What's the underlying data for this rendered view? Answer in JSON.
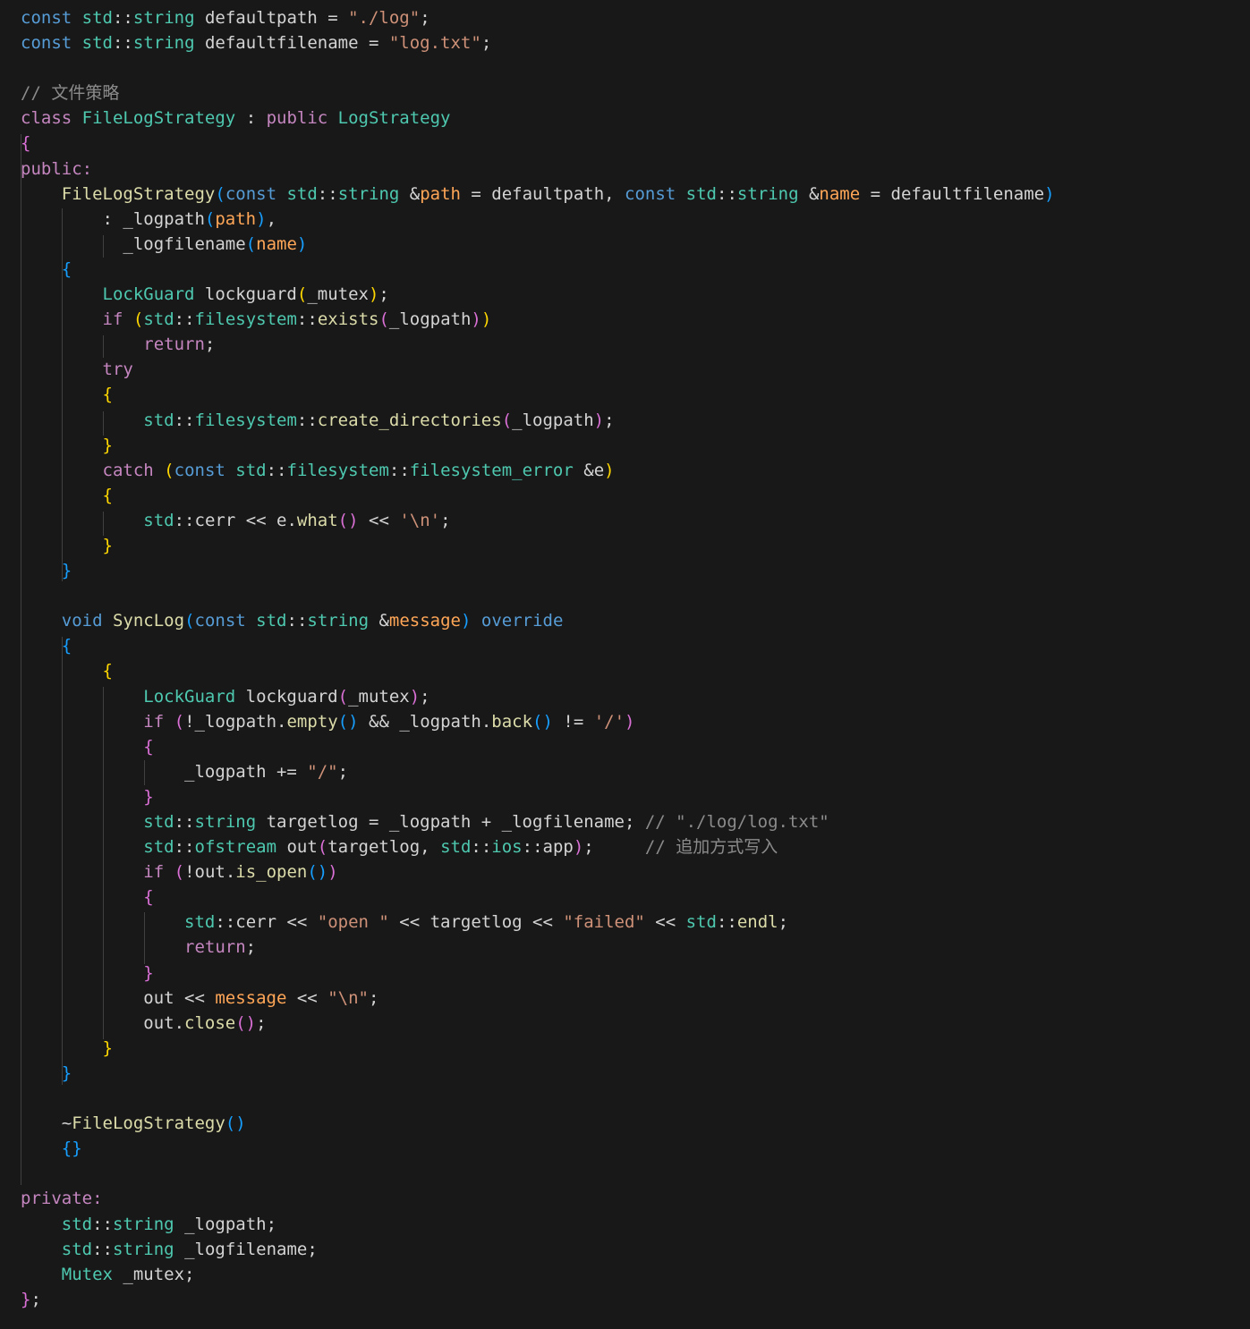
{
  "colors": {
    "background": "#181818",
    "guide": "#404040",
    "default": "#d4d4d4",
    "keyword": "#569cd6",
    "type": "#4ec9b0",
    "control": "#c586c0",
    "function": "#dcdcaa",
    "string": "#ce9178",
    "comment": "#8b8b8b",
    "param": "#ffa657",
    "bracket1": "#ffd700",
    "bracket2": "#da70d6",
    "bracket3": "#179fff",
    "name": "#ffffff"
  },
  "lines": [
    [
      [
        "const",
        "keyword"
      ],
      [
        " ",
        "plain"
      ],
      [
        "std",
        "type"
      ],
      [
        "::",
        "plain"
      ],
      [
        "string",
        "type"
      ],
      [
        " defaultpath = ",
        "plain"
      ],
      [
        "\"./log\"",
        "string"
      ],
      [
        ";",
        "plain"
      ]
    ],
    [
      [
        "const",
        "keyword"
      ],
      [
        " ",
        "plain"
      ],
      [
        "std",
        "type"
      ],
      [
        "::",
        "plain"
      ],
      [
        "string",
        "type"
      ],
      [
        " defaultfilename = ",
        "plain"
      ],
      [
        "\"log.txt\"",
        "string"
      ],
      [
        ";",
        "plain"
      ]
    ],
    [],
    [
      [
        "// 文件策略",
        "comment"
      ]
    ],
    [
      [
        "class",
        "control"
      ],
      [
        " ",
        "plain"
      ],
      [
        "FileLogStrategy",
        "type"
      ],
      [
        " : ",
        "plain"
      ],
      [
        "public",
        "control"
      ],
      [
        " ",
        "plain"
      ],
      [
        "LogStrategy",
        "type"
      ]
    ],
    [
      [
        "{",
        "bracket2"
      ]
    ],
    [
      [
        "public:",
        "control"
      ]
    ],
    [
      [
        "    ",
        "plain"
      ],
      [
        "FileLogStrategy",
        "function"
      ],
      [
        "(",
        "bracket3"
      ],
      [
        "const",
        "keyword"
      ],
      [
        " ",
        "plain"
      ],
      [
        "std",
        "type"
      ],
      [
        "::",
        "plain"
      ],
      [
        "string",
        "type"
      ],
      [
        " &",
        "plain"
      ],
      [
        "path",
        "param"
      ],
      [
        " = defaultpath, ",
        "plain"
      ],
      [
        "const",
        "keyword"
      ],
      [
        " ",
        "plain"
      ],
      [
        "std",
        "type"
      ],
      [
        "::",
        "plain"
      ],
      [
        "string",
        "type"
      ],
      [
        " &",
        "plain"
      ],
      [
        "name",
        "param"
      ],
      [
        " = defaultfilename",
        "plain"
      ],
      [
        ")",
        "bracket3"
      ]
    ],
    [
      [
        "        : _logpath",
        "plain"
      ],
      [
        "(",
        "bracket3"
      ],
      [
        "path",
        "param"
      ],
      [
        ")",
        "bracket3"
      ],
      [
        ",",
        "plain"
      ]
    ],
    [
      [
        "          _logfilename",
        "plain"
      ],
      [
        "(",
        "bracket3"
      ],
      [
        "name",
        "param"
      ],
      [
        ")",
        "bracket3"
      ]
    ],
    [
      [
        "    ",
        "plain"
      ],
      [
        "{",
        "bracket3"
      ]
    ],
    [
      [
        "        ",
        "plain"
      ],
      [
        "LockGuard",
        "type"
      ],
      [
        " lockguard",
        "plain"
      ],
      [
        "(",
        "bracket1"
      ],
      [
        "_mutex",
        "plain"
      ],
      [
        ")",
        "bracket1"
      ],
      [
        ";",
        "plain"
      ]
    ],
    [
      [
        "        ",
        "plain"
      ],
      [
        "if",
        "control"
      ],
      [
        " ",
        "plain"
      ],
      [
        "(",
        "bracket1"
      ],
      [
        "std",
        "type"
      ],
      [
        "::",
        "plain"
      ],
      [
        "filesystem",
        "type"
      ],
      [
        "::",
        "plain"
      ],
      [
        "exists",
        "function"
      ],
      [
        "(",
        "bracket2"
      ],
      [
        "_logpath",
        "plain"
      ],
      [
        ")",
        "bracket2"
      ],
      [
        ")",
        "bracket1"
      ]
    ],
    [
      [
        "            ",
        "plain"
      ],
      [
        "return",
        "control"
      ],
      [
        ";",
        "plain"
      ]
    ],
    [
      [
        "        ",
        "plain"
      ],
      [
        "try",
        "control"
      ]
    ],
    [
      [
        "        ",
        "plain"
      ],
      [
        "{",
        "bracket1"
      ]
    ],
    [
      [
        "            ",
        "plain"
      ],
      [
        "std",
        "type"
      ],
      [
        "::",
        "plain"
      ],
      [
        "filesystem",
        "type"
      ],
      [
        "::",
        "plain"
      ],
      [
        "create_directories",
        "function"
      ],
      [
        "(",
        "bracket2"
      ],
      [
        "_logpath",
        "plain"
      ],
      [
        ")",
        "bracket2"
      ],
      [
        ";",
        "plain"
      ]
    ],
    [
      [
        "        ",
        "plain"
      ],
      [
        "}",
        "bracket1"
      ]
    ],
    [
      [
        "        ",
        "plain"
      ],
      [
        "catch",
        "control"
      ],
      [
        " ",
        "plain"
      ],
      [
        "(",
        "bracket1"
      ],
      [
        "const",
        "keyword"
      ],
      [
        " ",
        "plain"
      ],
      [
        "std",
        "type"
      ],
      [
        "::",
        "plain"
      ],
      [
        "filesystem",
        "type"
      ],
      [
        "::",
        "plain"
      ],
      [
        "filesystem_error",
        "type"
      ],
      [
        " &e",
        "plain"
      ],
      [
        ")",
        "bracket1"
      ]
    ],
    [
      [
        "        ",
        "plain"
      ],
      [
        "{",
        "bracket1"
      ]
    ],
    [
      [
        "            ",
        "plain"
      ],
      [
        "std",
        "type"
      ],
      [
        "::",
        "plain"
      ],
      [
        "cerr",
        "plain"
      ],
      [
        " << e.",
        "plain"
      ],
      [
        "what",
        "function"
      ],
      [
        "()",
        "bracket2"
      ],
      [
        " << ",
        "plain"
      ],
      [
        "'\\n'",
        "string"
      ],
      [
        ";",
        "plain"
      ]
    ],
    [
      [
        "        ",
        "plain"
      ],
      [
        "}",
        "bracket1"
      ]
    ],
    [
      [
        "    ",
        "plain"
      ],
      [
        "}",
        "bracket3"
      ]
    ],
    [],
    [
      [
        "    ",
        "plain"
      ],
      [
        "void",
        "keyword"
      ],
      [
        " ",
        "plain"
      ],
      [
        "SyncLog",
        "function"
      ],
      [
        "(",
        "bracket3"
      ],
      [
        "const",
        "keyword"
      ],
      [
        " ",
        "plain"
      ],
      [
        "std",
        "type"
      ],
      [
        "::",
        "plain"
      ],
      [
        "string",
        "type"
      ],
      [
        " &",
        "plain"
      ],
      [
        "message",
        "param"
      ],
      [
        ")",
        "bracket3"
      ],
      [
        " ",
        "plain"
      ],
      [
        "override",
        "keyword"
      ]
    ],
    [
      [
        "    ",
        "plain"
      ],
      [
        "{",
        "bracket3"
      ]
    ],
    [
      [
        "        ",
        "plain"
      ],
      [
        "{",
        "bracket1"
      ]
    ],
    [
      [
        "            ",
        "plain"
      ],
      [
        "LockGuard",
        "type"
      ],
      [
        " lockguard",
        "plain"
      ],
      [
        "(",
        "bracket2"
      ],
      [
        "_mutex",
        "plain"
      ],
      [
        ")",
        "bracket2"
      ],
      [
        ";",
        "plain"
      ]
    ],
    [
      [
        "            ",
        "plain"
      ],
      [
        "if",
        "control"
      ],
      [
        " ",
        "plain"
      ],
      [
        "(",
        "bracket2"
      ],
      [
        "!_logpath.",
        "plain"
      ],
      [
        "empty",
        "function"
      ],
      [
        "()",
        "bracket3"
      ],
      [
        " && _logpath.",
        "plain"
      ],
      [
        "back",
        "function"
      ],
      [
        "()",
        "bracket3"
      ],
      [
        " != ",
        "plain"
      ],
      [
        "'/'",
        "string"
      ],
      [
        ")",
        "bracket2"
      ]
    ],
    [
      [
        "            ",
        "plain"
      ],
      [
        "{",
        "bracket2"
      ]
    ],
    [
      [
        "                _logpath += ",
        "plain"
      ],
      [
        "\"/\"",
        "string"
      ],
      [
        ";",
        "plain"
      ]
    ],
    [
      [
        "            ",
        "plain"
      ],
      [
        "}",
        "bracket2"
      ]
    ],
    [
      [
        "            ",
        "plain"
      ],
      [
        "std",
        "type"
      ],
      [
        "::",
        "plain"
      ],
      [
        "string",
        "type"
      ],
      [
        " targetlog = _logpath + _logfilename; ",
        "plain"
      ],
      [
        "// \"./log/log.txt\"",
        "comment"
      ]
    ],
    [
      [
        "            ",
        "plain"
      ],
      [
        "std",
        "type"
      ],
      [
        "::",
        "plain"
      ],
      [
        "ofstream",
        "type"
      ],
      [
        " out",
        "plain"
      ],
      [
        "(",
        "bracket2"
      ],
      [
        "targetlog, ",
        "plain"
      ],
      [
        "std",
        "type"
      ],
      [
        "::",
        "plain"
      ],
      [
        "ios",
        "type"
      ],
      [
        "::app",
        "plain"
      ],
      [
        ")",
        "bracket2"
      ],
      [
        ";     ",
        "plain"
      ],
      [
        "// 追加方式写入",
        "comment"
      ]
    ],
    [
      [
        "            ",
        "plain"
      ],
      [
        "if",
        "control"
      ],
      [
        " ",
        "plain"
      ],
      [
        "(",
        "bracket2"
      ],
      [
        "!out.",
        "plain"
      ],
      [
        "is_open",
        "function"
      ],
      [
        "()",
        "bracket3"
      ],
      [
        ")",
        "bracket2"
      ]
    ],
    [
      [
        "            ",
        "plain"
      ],
      [
        "{",
        "bracket2"
      ]
    ],
    [
      [
        "                ",
        "plain"
      ],
      [
        "std",
        "type"
      ],
      [
        "::",
        "plain"
      ],
      [
        "cerr",
        "plain"
      ],
      [
        " << ",
        "plain"
      ],
      [
        "\"open \"",
        "string"
      ],
      [
        " << targetlog << ",
        "plain"
      ],
      [
        "\"failed\"",
        "string"
      ],
      [
        " << ",
        "plain"
      ],
      [
        "std",
        "type"
      ],
      [
        "::",
        "plain"
      ],
      [
        "endl",
        "function"
      ],
      [
        ";",
        "plain"
      ]
    ],
    [
      [
        "                ",
        "plain"
      ],
      [
        "return",
        "control"
      ],
      [
        ";",
        "plain"
      ]
    ],
    [
      [
        "            ",
        "plain"
      ],
      [
        "}",
        "bracket2"
      ]
    ],
    [
      [
        "            out << ",
        "plain"
      ],
      [
        "message",
        "param"
      ],
      [
        " << ",
        "plain"
      ],
      [
        "\"\\n\"",
        "string"
      ],
      [
        ";",
        "plain"
      ]
    ],
    [
      [
        "            out.",
        "plain"
      ],
      [
        "close",
        "function"
      ],
      [
        "()",
        "bracket2"
      ],
      [
        ";",
        "plain"
      ]
    ],
    [
      [
        "        ",
        "plain"
      ],
      [
        "}",
        "bracket1"
      ]
    ],
    [
      [
        "    ",
        "plain"
      ],
      [
        "}",
        "bracket3"
      ]
    ],
    [],
    [
      [
        "    ~",
        "plain"
      ],
      [
        "FileLogStrategy",
        "function"
      ],
      [
        "()",
        "bracket3"
      ]
    ],
    [
      [
        "    ",
        "plain"
      ],
      [
        "{}",
        "bracket3"
      ]
    ],
    [],
    [
      [
        "private:",
        "control"
      ]
    ],
    [
      [
        "    ",
        "plain"
      ],
      [
        "std",
        "type"
      ],
      [
        "::",
        "plain"
      ],
      [
        "string",
        "type"
      ],
      [
        " _logpath;",
        "plain"
      ]
    ],
    [
      [
        "    ",
        "plain"
      ],
      [
        "std",
        "type"
      ],
      [
        "::",
        "plain"
      ],
      [
        "string",
        "type"
      ],
      [
        " _logfilename;",
        "plain"
      ]
    ],
    [
      [
        "    ",
        "plain"
      ],
      [
        "Mutex",
        "type"
      ],
      [
        " _mutex;",
        "plain"
      ]
    ],
    [
      [
        "}",
        "bracket2"
      ],
      [
        ";",
        "plain"
      ]
    ]
  ]
}
